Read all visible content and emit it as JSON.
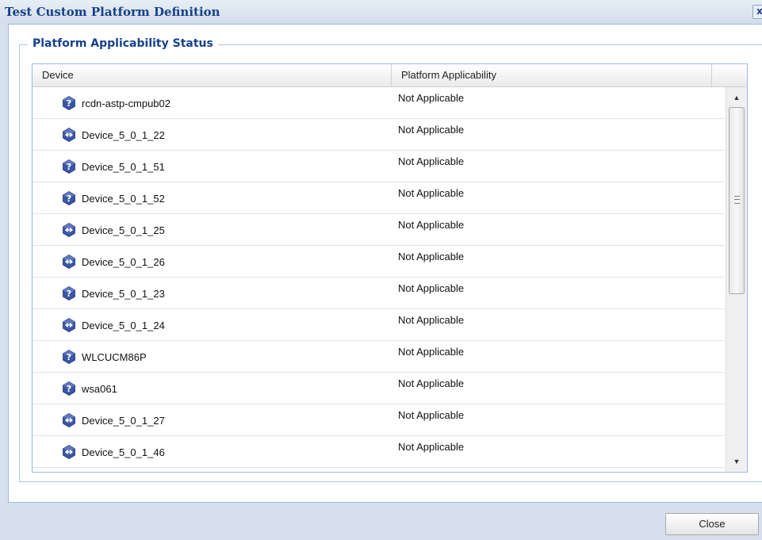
{
  "dialog": {
    "title": "Test Custom Platform Definition",
    "close_glyph": "x"
  },
  "fieldset": {
    "legend": "Platform Applicability Status"
  },
  "grid": {
    "columns": [
      "Device",
      "Platform Applicability"
    ],
    "rows": [
      {
        "device": "rcdn-astp-cmpub02",
        "icon": "unknown-device-icon",
        "applicability": "Not Applicable"
      },
      {
        "device": "Device_5_0_1_22",
        "icon": "network-device-icon",
        "applicability": "Not Applicable"
      },
      {
        "device": "Device_5_0_1_51",
        "icon": "unknown-device-icon",
        "applicability": "Not Applicable"
      },
      {
        "device": "Device_5_0_1_52",
        "icon": "unknown-device-icon",
        "applicability": "Not Applicable"
      },
      {
        "device": "Device_5_0_1_25",
        "icon": "network-device-icon",
        "applicability": "Not Applicable"
      },
      {
        "device": "Device_5_0_1_26",
        "icon": "network-device-icon",
        "applicability": "Not Applicable"
      },
      {
        "device": "Device_5_0_1_23",
        "icon": "unknown-device-icon",
        "applicability": "Not Applicable"
      },
      {
        "device": "Device_5_0_1_24",
        "icon": "network-device-icon",
        "applicability": "Not Applicable"
      },
      {
        "device": "WLCUCM86P",
        "icon": "unknown-device-icon",
        "applicability": "Not Applicable"
      },
      {
        "device": "wsa061",
        "icon": "unknown-device-icon",
        "applicability": "Not Applicable"
      },
      {
        "device": "Device_5_0_1_27",
        "icon": "network-device-icon",
        "applicability": "Not Applicable"
      },
      {
        "device": "Device_5_0_1_46",
        "icon": "network-device-icon",
        "applicability": "Not Applicable"
      }
    ]
  },
  "footer": {
    "close_label": "Close"
  },
  "colors": {
    "title": "#15428b",
    "dialog_bg": "#d6e0ec",
    "grid_border": "#99bbe8",
    "icon_blue": "#3a56a8"
  }
}
